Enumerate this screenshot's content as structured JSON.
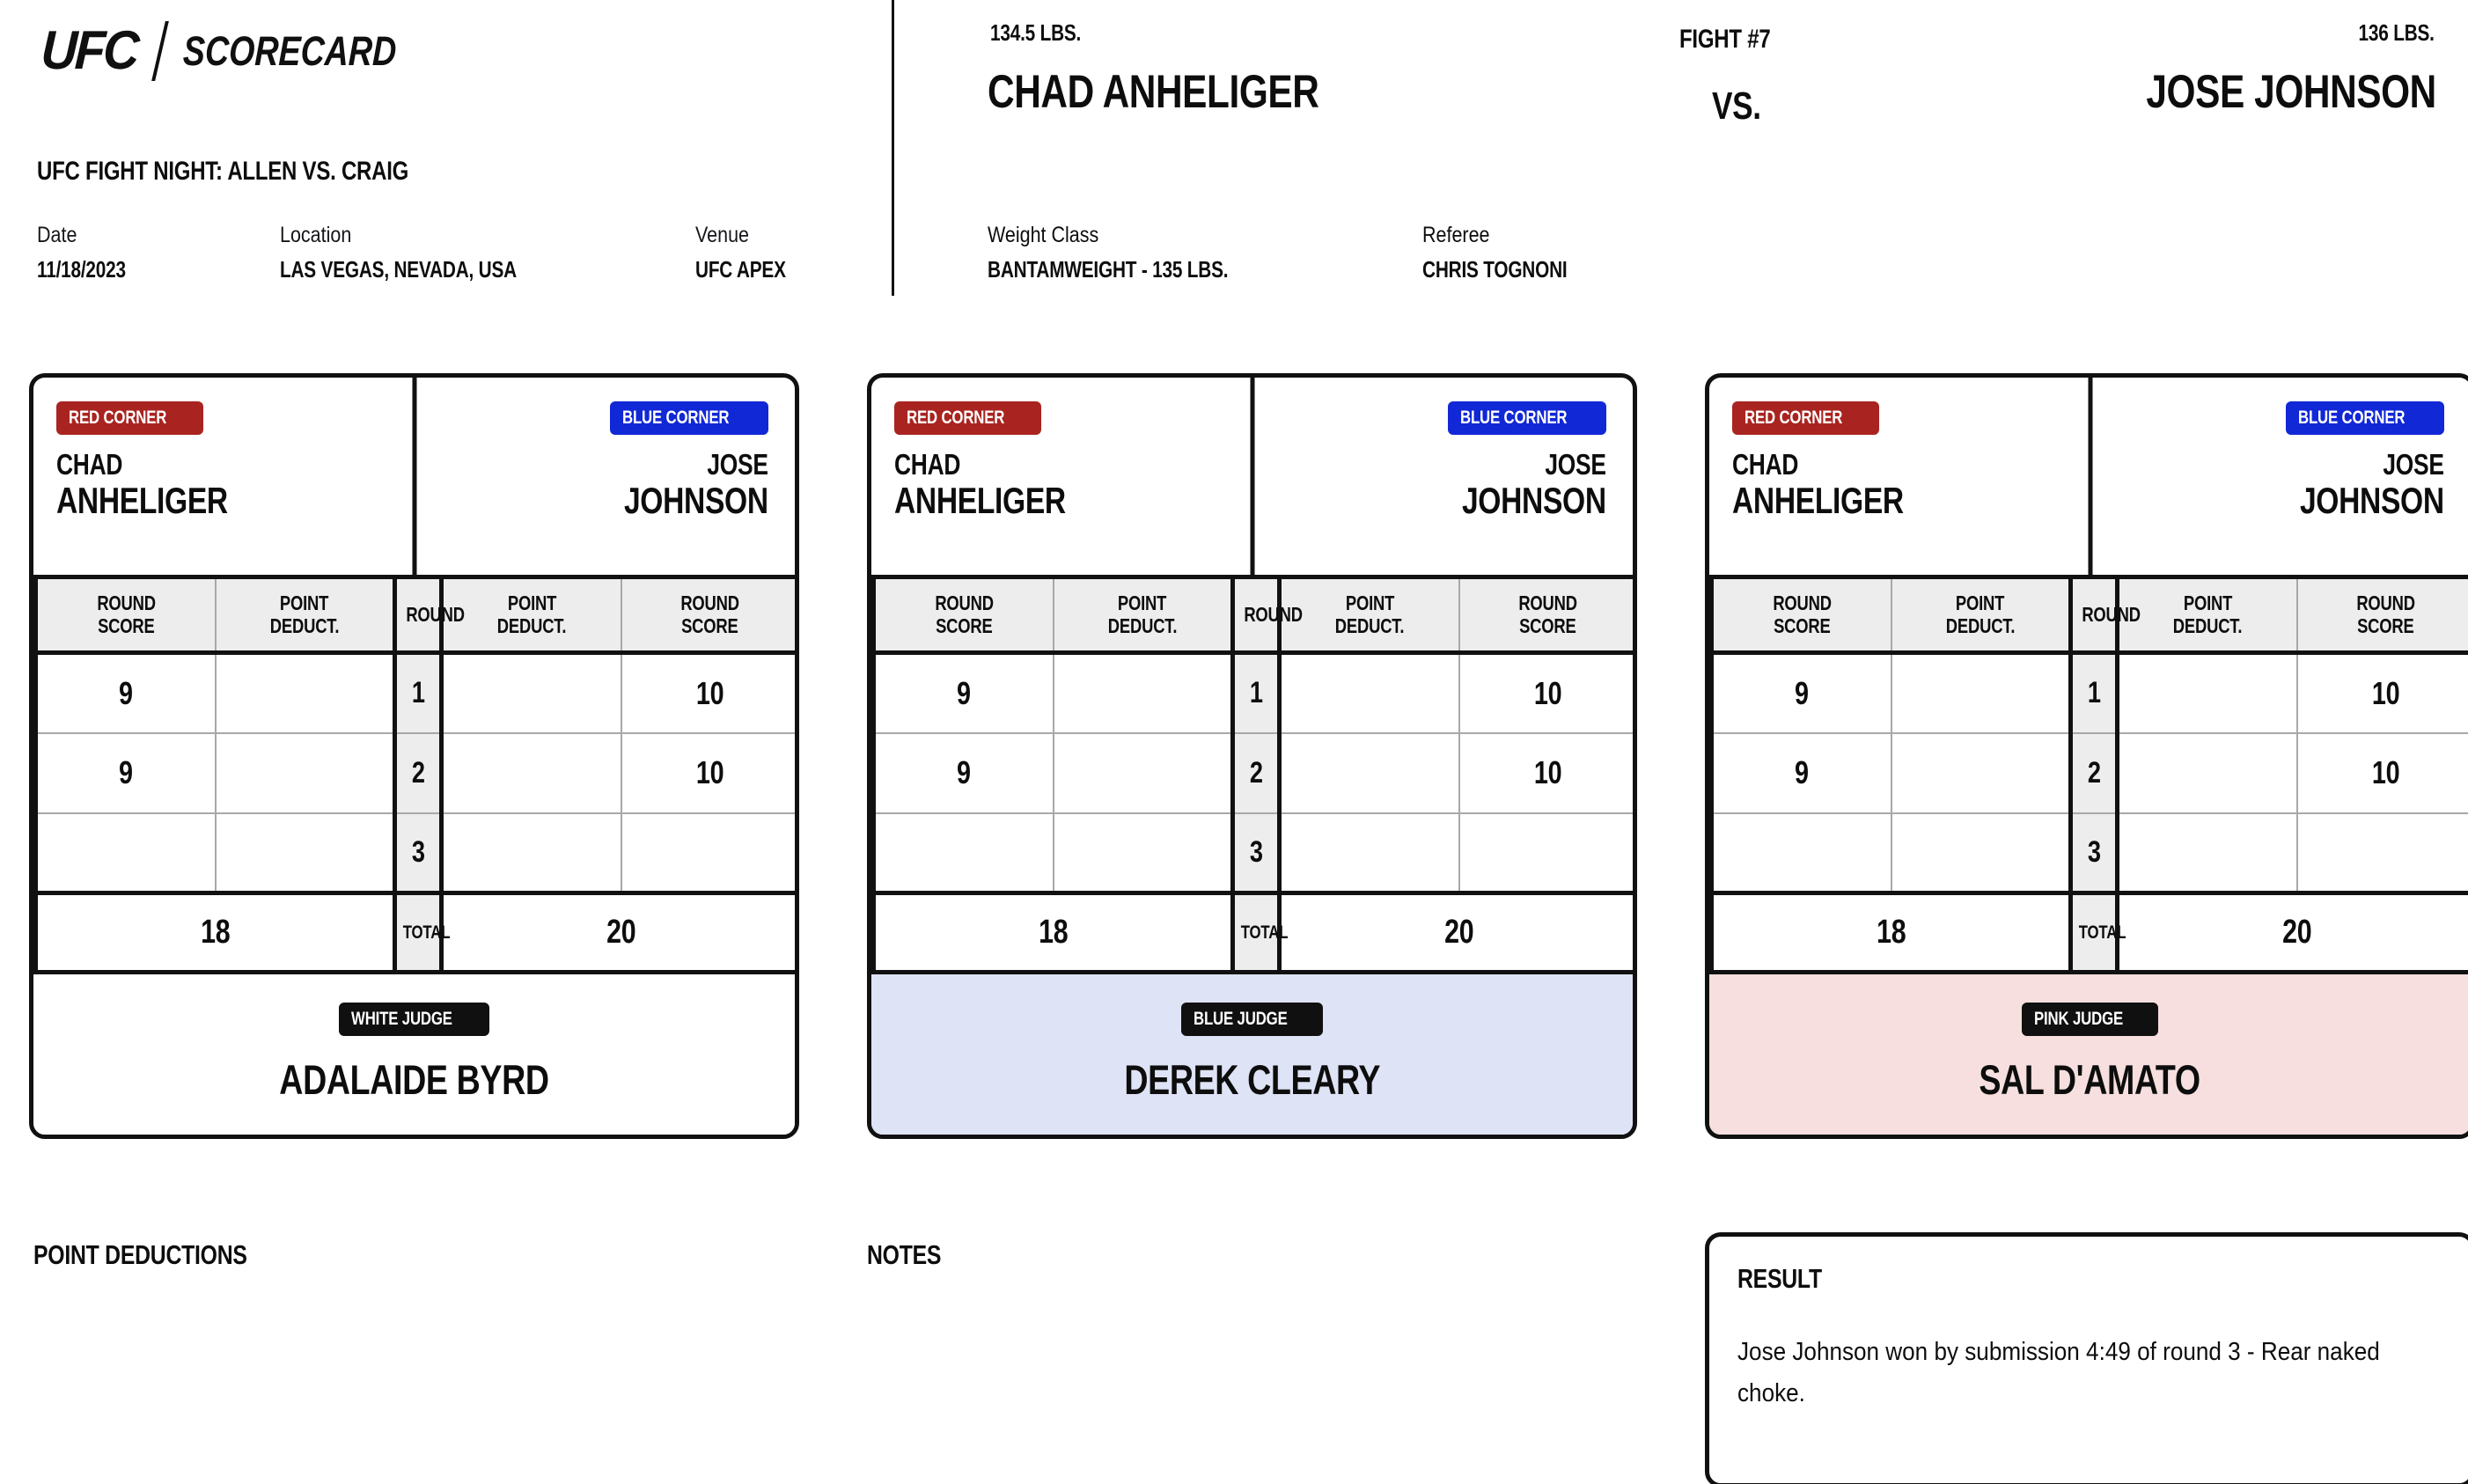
{
  "brand": {
    "mark": "UFC",
    "divider": "/",
    "word": "SCORECARD"
  },
  "event": {
    "title": "UFC FIGHT NIGHT: ALLEN VS. CRAIG",
    "date_label": "Date",
    "date_value": "11/18/2023",
    "location_label": "Location",
    "location_value": "LAS VEGAS, NEVADA, USA",
    "venue_label": "Venue",
    "venue_value": "UFC APEX"
  },
  "bout": {
    "fight_number": "FIGHT #7",
    "vs": "VS.",
    "red_weight": "134.5 LBS.",
    "red_name": "CHAD ANHELIGER",
    "blue_weight": "136 LBS.",
    "blue_name": "JOSE JOHNSON",
    "weight_class_label": "Weight Class",
    "weight_class_value": "BANTAMWEIGHT - 135 LBS.",
    "referee_label": "Referee",
    "referee_value": "CHRIS TOGNONI"
  },
  "table_headers": {
    "round_score": "ROUND SCORE",
    "round_score_l1": "ROUND",
    "round_score_l2": "SCORE",
    "point_deduct_l1": "POINT",
    "point_deduct_l2": "DEDUCT.",
    "round": "ROUND",
    "total": "TOTAL"
  },
  "corners": {
    "red_badge": "RED CORNER",
    "blue_badge": "BLUE CORNER",
    "red_first": "CHAD",
    "red_last": "ANHELIGER",
    "blue_first": "JOSE",
    "blue_last": "JOHNSON"
  },
  "scorecards": [
    {
      "judge_badge": "WHITE JUDGE",
      "judge_name": "ADALAIDE BYRD",
      "theme": "white",
      "rows": [
        {
          "round": "1",
          "red_score": "9",
          "red_deduct": "",
          "blue_deduct": "",
          "blue_score": "10"
        },
        {
          "round": "2",
          "red_score": "9",
          "red_deduct": "",
          "blue_deduct": "",
          "blue_score": "10"
        },
        {
          "round": "3",
          "red_score": "",
          "red_deduct": "",
          "blue_deduct": "",
          "blue_score": ""
        }
      ],
      "red_total": "18",
      "blue_total": "20"
    },
    {
      "judge_badge": "BLUE JUDGE",
      "judge_name": "DEREK CLEARY",
      "theme": "blue",
      "rows": [
        {
          "round": "1",
          "red_score": "9",
          "red_deduct": "",
          "blue_deduct": "",
          "blue_score": "10"
        },
        {
          "round": "2",
          "red_score": "9",
          "red_deduct": "",
          "blue_deduct": "",
          "blue_score": "10"
        },
        {
          "round": "3",
          "red_score": "",
          "red_deduct": "",
          "blue_deduct": "",
          "blue_score": ""
        }
      ],
      "red_total": "18",
      "blue_total": "20"
    },
    {
      "judge_badge": "PINK JUDGE",
      "judge_name": "SAL D'AMATO",
      "theme": "pink",
      "rows": [
        {
          "round": "1",
          "red_score": "9",
          "red_deduct": "",
          "blue_deduct": "",
          "blue_score": "10"
        },
        {
          "round": "2",
          "red_score": "9",
          "red_deduct": "",
          "blue_deduct": "",
          "blue_score": "10"
        },
        {
          "round": "3",
          "red_score": "",
          "red_deduct": "",
          "blue_deduct": "",
          "blue_score": ""
        }
      ],
      "red_total": "18",
      "blue_total": "20"
    }
  ],
  "bottom": {
    "point_deductions_title": "POINT DEDUCTIONS",
    "point_deductions_text": "",
    "notes_title": "NOTES",
    "notes_text": "",
    "result_title": "RESULT",
    "result_text": "Jose Johnson won by submission 4:49 of round 3 - Rear naked choke."
  },
  "colors": {
    "red_corner": "#a92420",
    "blue_corner": "#1128d6",
    "ink": "#101010",
    "header_fill": "#ededed",
    "blue_judge_fill": "#dee3f5",
    "pink_judge_fill": "#f6dfde"
  }
}
